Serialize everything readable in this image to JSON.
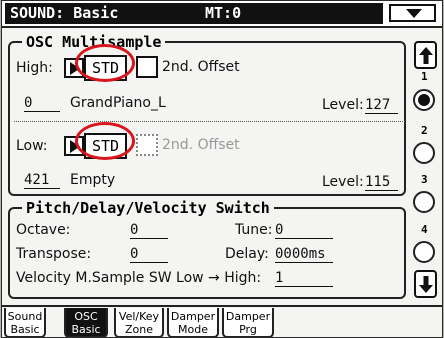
{
  "header": {
    "title": "SOUND: Basic",
    "mt": "MT:0"
  },
  "osc": {
    "group_title": "OSC Multisample",
    "high": {
      "label": "High:",
      "mode": "STD",
      "offset_label": "2nd. Offset",
      "sample_number": "0",
      "sample_name": "GrandPiano_L",
      "level_label": "Level:",
      "level": "127"
    },
    "low": {
      "label": "Low:",
      "mode": "STD",
      "offset_label": "2nd. Offset",
      "sample_number": "421",
      "sample_name": "Empty",
      "level_label": "Level:",
      "level": "115"
    }
  },
  "pitch": {
    "group_title": "Pitch/Delay/Velocity Switch",
    "octave_label": "Octave:",
    "octave": "0",
    "tune_label": "Tune:",
    "tune": "0",
    "transpose_label": "Transpose:",
    "transpose": "0",
    "delay_label": "Delay:",
    "delay": "0000ms",
    "velocity_label": "Velocity M.Sample SW Low → High:",
    "velocity": "1"
  },
  "side": {
    "numbers": [
      "1",
      "2",
      "3",
      "4"
    ],
    "selected": "1"
  },
  "tabs": [
    {
      "line1": "Sound",
      "line2": "Basic",
      "active": false
    },
    {
      "line1": "OSC",
      "line2": "Basic",
      "active": true
    },
    {
      "line1": "Vel/Key",
      "line2": "Zone",
      "active": false
    },
    {
      "line1": "Damper",
      "line2": "Mode",
      "active": false
    },
    {
      "line1": "Damper",
      "line2": "Prg",
      "active": false
    }
  ],
  "annotation": {
    "color": "#d8141c"
  }
}
